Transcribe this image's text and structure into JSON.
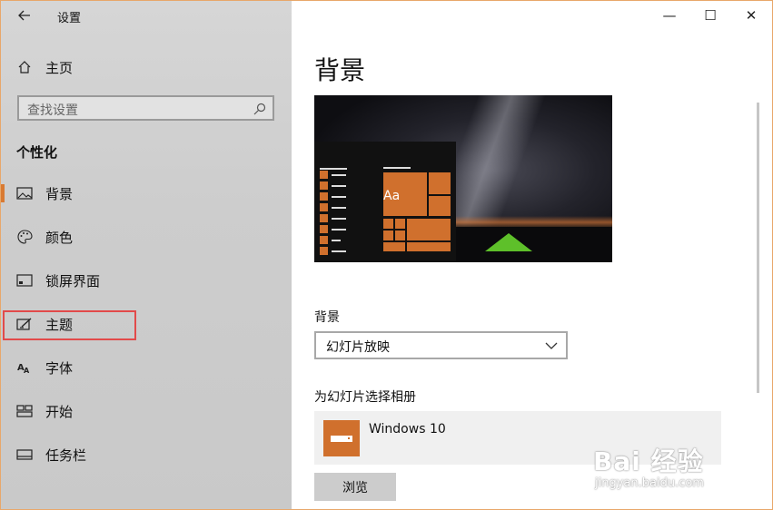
{
  "window": {
    "title": "设置"
  },
  "titlebar": {
    "minimize_label": "—",
    "maximize_label": "☐",
    "close_label": "✕"
  },
  "sidebar": {
    "home_label": "主页",
    "search_placeholder": "查找设置",
    "section_title": "个性化",
    "items": [
      {
        "label": "背景",
        "icon": "image-icon",
        "active": true
      },
      {
        "label": "颜色",
        "icon": "palette-icon"
      },
      {
        "label": "锁屏界面",
        "icon": "lock-screen-icon"
      },
      {
        "label": "主题",
        "icon": "theme-icon",
        "highlighted": true
      },
      {
        "label": "字体",
        "icon": "font-icon"
      },
      {
        "label": "开始",
        "icon": "start-icon"
      },
      {
        "label": "任务栏",
        "icon": "taskbar-icon"
      }
    ]
  },
  "main": {
    "page_title": "背景",
    "preview_sample_text": "Aa",
    "background_label": "背景",
    "background_value": "幻灯片放映",
    "album_label": "为幻灯片选择相册",
    "album_name": "Windows 10",
    "browse_label": "浏览"
  },
  "watermark": {
    "line1": "Bai 经验",
    "line2": "jingyan.baidu.com"
  },
  "colors": {
    "accent": "#d0702d",
    "highlight_box": "#e24a4a",
    "tent": "#5ec02a"
  }
}
